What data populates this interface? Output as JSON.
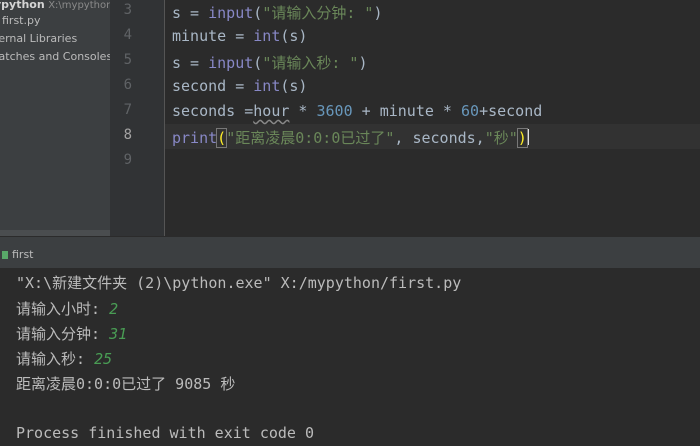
{
  "project_panel": {
    "root_name": "ypython",
    "root_path": "X:\\mypython",
    "file": "first.py",
    "external_libraries": "ternal Libraries",
    "scratches": "ratches and Consoles"
  },
  "editor": {
    "line_numbers": [
      "3",
      "4",
      "5",
      "6",
      "7",
      "8",
      "9"
    ],
    "current_line": "8",
    "lines": {
      "l3": {
        "var": "s = ",
        "fn": "input",
        "open": "(",
        "str": "\"请输入分钟: \"",
        "close": ")"
      },
      "l4": {
        "var": "minute = ",
        "fn": "int",
        "rest": "(s)"
      },
      "l5": {
        "var": "s = ",
        "fn": "input",
        "open": "(",
        "str": "\"请输入秒: \"",
        "close": ")"
      },
      "l6": {
        "var": "second = ",
        "fn": "int",
        "rest": "(s)"
      },
      "l7": {
        "a": "seconds =",
        "hour": "hour",
        "b": " * ",
        "n1": "3600",
        "c": " + minute * ",
        "n2": "60",
        "d": "+second"
      },
      "l8": {
        "fn": "print",
        "open": "(",
        "str1": "\"距离凌晨0:0:0已过了\"",
        "mid": ", seconds,",
        "str2": "\"秒\"",
        "close": ")"
      }
    }
  },
  "run_panel": {
    "tab_label": "first"
  },
  "console": {
    "command": "\"X:\\新建文件夹 (2)\\python.exe\" X:/mypython/first.py",
    "prompt_hour": "请输入小时: ",
    "input_hour": "2",
    "prompt_minute": "请输入分钟: ",
    "input_minute": "31",
    "prompt_second": "请输入秒: ",
    "input_second": "25",
    "result": "距离凌晨0:0:0已过了 9085 秒",
    "exit": "Process finished with exit code 0"
  },
  "colors": {
    "editor_bg": "#2b2b2b",
    "panel_bg": "#3c3f41",
    "keyword_fn": "#8888c6",
    "string": "#6a8759",
    "number": "#6897bb",
    "user_input": "#499c54"
  }
}
